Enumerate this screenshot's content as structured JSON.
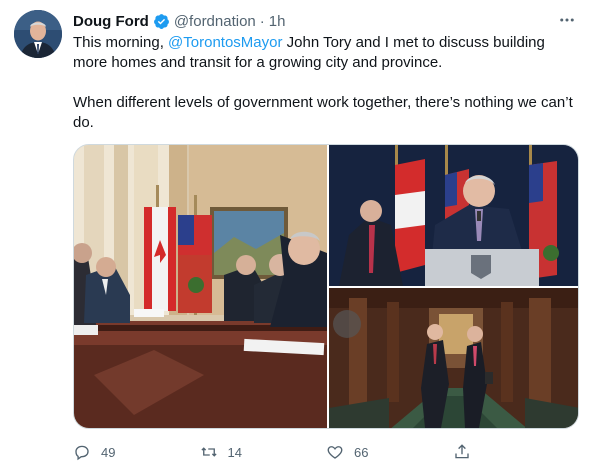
{
  "tweet": {
    "author_name": "Doug Ford",
    "handle": "@fordnation",
    "separator": "·",
    "time": "1h",
    "text_part1": "This morning, ",
    "mention": "@TorontosMayor",
    "text_part2": " John Tory and I met to discuss building more homes and transit for a growing city and province.",
    "paragraph2": "When different levels of government work together, there’s nothing we can’t do."
  },
  "actions": {
    "reply_count": "49",
    "retweet_count": "14",
    "like_count": "66"
  },
  "colors": {
    "accent": "#1d9bf0",
    "secondary_text": "#536471",
    "border": "#cfd9de"
  },
  "icons": [
    "verified-badge-icon",
    "more-icon",
    "reply-icon",
    "retweet-icon",
    "like-icon",
    "share-icon"
  ]
}
